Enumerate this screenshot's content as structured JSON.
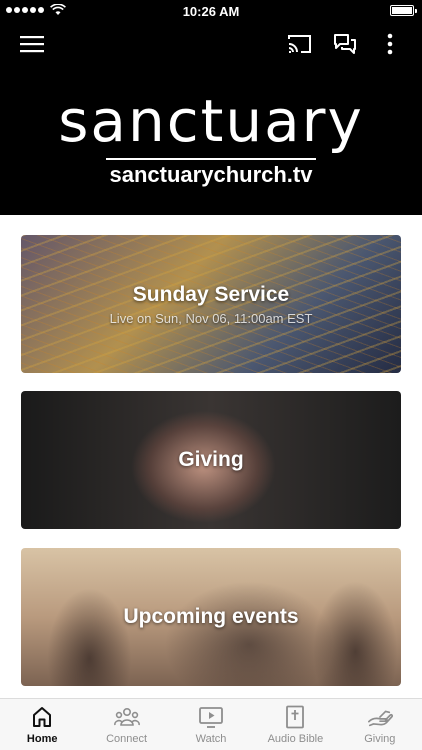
{
  "status_bar": {
    "time": "10:26 AM"
  },
  "header": {
    "logo_word": "sanctuary",
    "logo_url": "sanctuarychurch.tv"
  },
  "cards": [
    {
      "title": "Sunday Service",
      "subtitle": "Live on Sun, Nov 06, 11:00am EST"
    },
    {
      "title": "Giving"
    },
    {
      "title": "Upcoming events"
    }
  ],
  "bottom_nav": {
    "items": [
      {
        "label": "Home",
        "icon": "home-icon",
        "active": true
      },
      {
        "label": "Connect",
        "icon": "people-icon"
      },
      {
        "label": "Watch",
        "icon": "tv-icon"
      },
      {
        "label": "Audio Bible",
        "icon": "bible-icon"
      },
      {
        "label": "Giving",
        "icon": "giving-hand-icon"
      }
    ]
  },
  "colors": {
    "header_bg": "#000000",
    "active_nav": "#111111",
    "inactive_nav": "#8e8e8e"
  }
}
